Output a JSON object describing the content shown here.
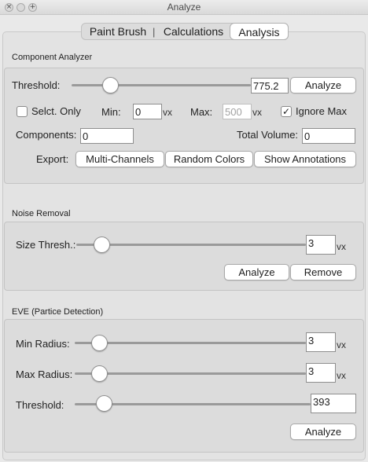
{
  "window": {
    "title": "Analyze"
  },
  "tabs": [
    {
      "label": "Paint Brush",
      "selected": false
    },
    {
      "label": "Calculations",
      "selected": false
    },
    {
      "label": "Analysis",
      "selected": true
    }
  ],
  "tab_separator": "|",
  "component_analyzer": {
    "heading": "Component Analyzer",
    "threshold_label": "Threshold:",
    "threshold_value": "775.2",
    "threshold_slider_fraction": 0.23,
    "analyze_button": "Analyze",
    "select_only_label": "Selct. Only",
    "select_only_checked": false,
    "min_label": "Min:",
    "min_value": "0",
    "min_unit": "vx",
    "max_label": "Max:",
    "max_value": "500",
    "max_unit": "vx",
    "ignore_max_label": "Ignore Max",
    "ignore_max_checked": true,
    "components_label": "Components:",
    "components_value": "0",
    "total_volume_label": "Total Volume:",
    "total_volume_value": "0",
    "export_label": "Export:",
    "export_buttons": [
      "Multi-Channels",
      "Random Colors",
      "Show Annotations"
    ]
  },
  "noise_removal": {
    "heading": "Noise Removal",
    "size_thresh_label": "Size Thresh.:",
    "size_thresh_value": "3",
    "size_thresh_unit": "vx",
    "analyze_button": "Analyze",
    "remove_button": "Remove"
  },
  "eve": {
    "heading": "EVE (Partice Detection)",
    "min_radius_label": "Min Radius:",
    "min_radius_value": "3",
    "min_radius_unit": "vx",
    "max_radius_label": "Max Radius:",
    "max_radius_value": "3",
    "max_radius_unit": "vx",
    "threshold_label": "Threshold:",
    "threshold_value": "393",
    "analyze_button": "Analyze"
  },
  "icons": {
    "close": "close-icon",
    "minimize": "minimize-icon",
    "zoom": "zoom-icon",
    "checkmark": "checkmark-icon"
  }
}
